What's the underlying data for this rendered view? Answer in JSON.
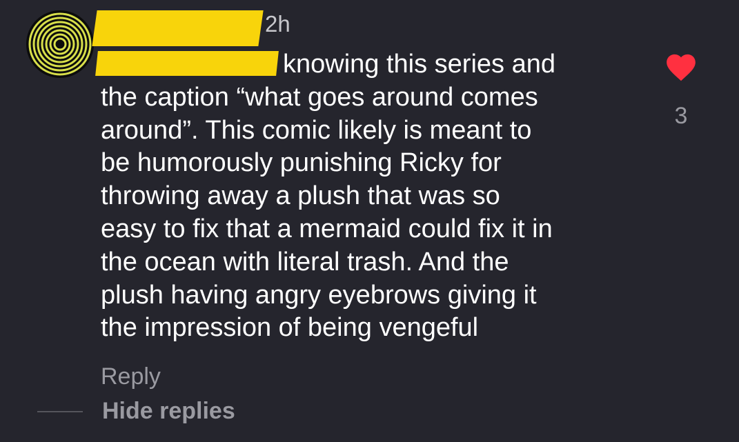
{
  "comment": {
    "timestamp": "2h",
    "lines": [
      "knowing this series and",
      "the caption “what goes around comes",
      "around”. This comic likely is meant to",
      "be humorously punishing Ricky for",
      "throwing away a plush that was so",
      "easy to fix that a mermaid could fix it in",
      "the ocean with literal trash. And the",
      "plush having angry eyebrows giving it",
      "the impression of being vengeful"
    ],
    "like_count": "3",
    "liked": true
  },
  "actions": {
    "reply_label": "Reply",
    "hide_replies_label": "Hide replies"
  },
  "icons": {
    "avatar": "concentric-rings-avatar",
    "like": "heart-icon"
  },
  "colors": {
    "background": "#25252d",
    "text": "#ffffff",
    "secondary_text": "#9a9aa1",
    "heart": "#ff3040",
    "redaction": "#f8d40b"
  }
}
